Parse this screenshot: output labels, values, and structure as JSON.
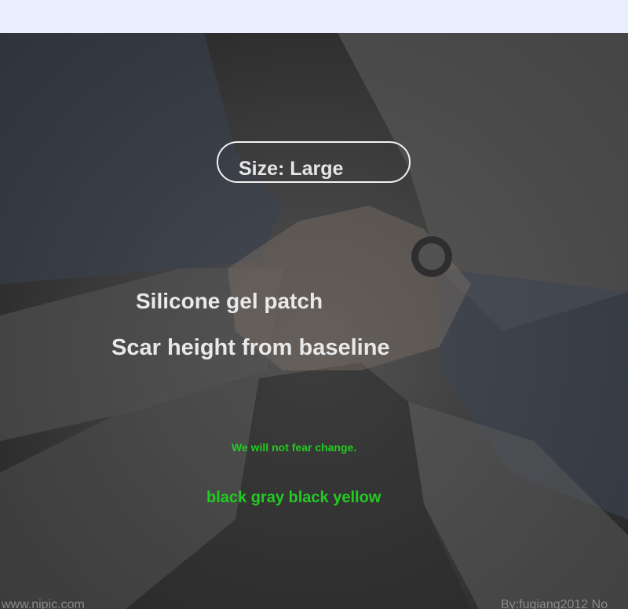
{
  "size_label": "Size: Large",
  "headline": "Silicone gel patch",
  "subheadline": "Scar height from baseline",
  "motto": "We will not fear change.",
  "color_list": "black gray black yellow",
  "watermark_left": "www.nipic.com",
  "watermark_right": "By:fuqiang2012 No"
}
